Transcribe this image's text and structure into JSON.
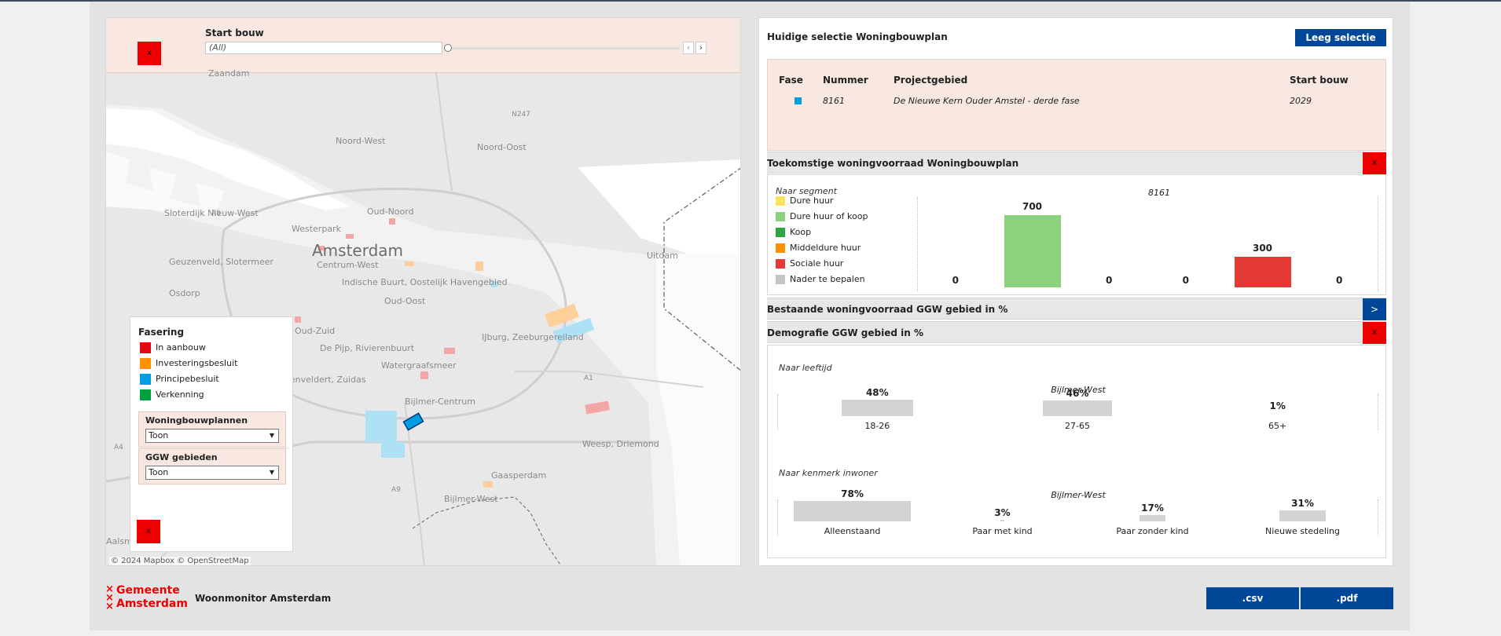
{
  "filter": {
    "title": "Start bouw",
    "value": "(All)",
    "prev_icon": "chevron-left-icon",
    "next_icon": "chevron-right-icon",
    "close_label": "x"
  },
  "map": {
    "labels": {
      "zaandam": "Zaandam",
      "noordwest": "Noord-West",
      "noordoost": "Noord-Oost",
      "n247": "N247",
      "sloterdijk": "Sloterdijk Nieuw-West",
      "a5": "A5",
      "oudnoord": "Oud-Noord",
      "westerpark": "Westerpark",
      "amsterdam": "Amsterdam",
      "geuzenveld": "Geuzenveld, Slotermeer",
      "centrumwest": "Centrum-West",
      "uitdam": "Uitdam",
      "indische": "Indische Buurt, Oostelijk Havengebied",
      "osdorp": "Osdorp",
      "oudoost": "Oud-Oost",
      "oudzuid": "Oud-Zuid",
      "ijburg": "IJburg, Zeeburgereiland",
      "depijp": "De Pijp, Rivierenbuurt",
      "watergraafsmeer": "Watergraafsmeer",
      "buitenveldert": "Buitenveldert, Zuidas",
      "a1": "A1",
      "bijlmercentrum": "Bijlmer-Centrum",
      "a4": "A4",
      "weesp": "Weesp, Driemond",
      "gaasperdam": "Gaasperdam",
      "a9": "A9",
      "bijlmerwest": "Bijlmer-West",
      "aalsmeer": "Aalsm"
    },
    "attribution": "© 2024 Mapbox  © OpenStreetMap",
    "legend": {
      "title": "Fasering",
      "items": [
        {
          "label": "In aanbouw",
          "color": "#e30613"
        },
        {
          "label": "Investeringsbesluit",
          "color": "#ff9100"
        },
        {
          "label": "Principebesluit",
          "color": "#009de0"
        },
        {
          "label": "Verkenning",
          "color": "#00a03c"
        }
      ],
      "woningbouwplannen": {
        "title": "Woningbouwplannen",
        "value": "Toon"
      },
      "ggw": {
        "title": "GGW gebieden",
        "value": "Toon"
      },
      "close_label": "x"
    }
  },
  "selection": {
    "title": "Huidige selectie Woningbouwplan",
    "clear_button": "Leeg selectie",
    "headers": {
      "fase": "Fase",
      "nummer": "Nummer",
      "projectgebied": "Projectgebied",
      "startbouw": "Start bouw"
    },
    "row": {
      "fase_color": "#009de0",
      "nummer": "8161",
      "projectgebied": "De Nieuwe Kern Ouder Amstel - derde fase",
      "startbouw": "2029"
    }
  },
  "sections": {
    "toekomstig": {
      "title": "Toekomstige woningvoorraad Woningbouwplan",
      "toggle": "x"
    },
    "bestaand": {
      "title": "Bestaande woningvoorraad GGW gebied in %",
      "toggle": ">"
    },
    "demografie": {
      "title": "Demografie GGW gebied in %",
      "toggle": "x"
    }
  },
  "segment": {
    "subtitle": "Naar segment",
    "legend": [
      {
        "label": "Dure huur",
        "color": "#ffe35c"
      },
      {
        "label": "Dure huur of koop",
        "color": "#8cd17d"
      },
      {
        "label": "Koop",
        "color": "#2fa447"
      },
      {
        "label": "Middeldure huur",
        "color": "#ff9100"
      },
      {
        "label": "Sociale huur",
        "color": "#e53935"
      },
      {
        "label": "Nader te bepalen",
        "color": "#c4c4c4"
      }
    ]
  },
  "demo": {
    "leeftijd_subtitle": "Naar leeftijd",
    "kenmerk_subtitle": "Naar kenmerk inwoner"
  },
  "chart_data": [
    {
      "type": "bar",
      "title": "8161",
      "categories": [
        "Dure huur",
        "Dure huur of koop",
        "Koop",
        "Middeldure huur",
        "Sociale huur",
        "Nader te bepalen"
      ],
      "values": [
        0,
        700,
        0,
        0,
        300,
        0
      ],
      "colors": [
        "#ffe35c",
        "#8cd17d",
        "#2fa447",
        "#ff9100",
        "#e53935",
        "#c4c4c4"
      ],
      "ylim": [
        0,
        700
      ],
      "value_labels": [
        "0",
        "700",
        "0",
        "0",
        "300",
        "0"
      ],
      "legend": "left"
    },
    {
      "type": "bar",
      "title": "Bijlmer-West",
      "categories": [
        "18-26",
        "27-65",
        "65+"
      ],
      "values": [
        48,
        46,
        1
      ],
      "value_labels": [
        "48%",
        "46%",
        "1%"
      ],
      "ylim": [
        0,
        100
      ]
    },
    {
      "type": "bar",
      "title": "Bijlmer-West",
      "categories": [
        "Alleenstaand",
        "Paar met kind",
        "Paar zonder kind",
        "Nieuwe stedeling"
      ],
      "values": [
        78,
        3,
        17,
        31
      ],
      "value_labels": [
        "78%",
        "3%",
        "17%",
        "31%"
      ],
      "ylim": [
        0,
        100
      ]
    }
  ],
  "footer": {
    "logo_line1": "Gemeente",
    "logo_line2": "Amsterdam",
    "logo_cross": "×",
    "app_title": "Woonmonitor Amsterdam",
    "csv_button": ".csv",
    "pdf_button": ".pdf"
  }
}
